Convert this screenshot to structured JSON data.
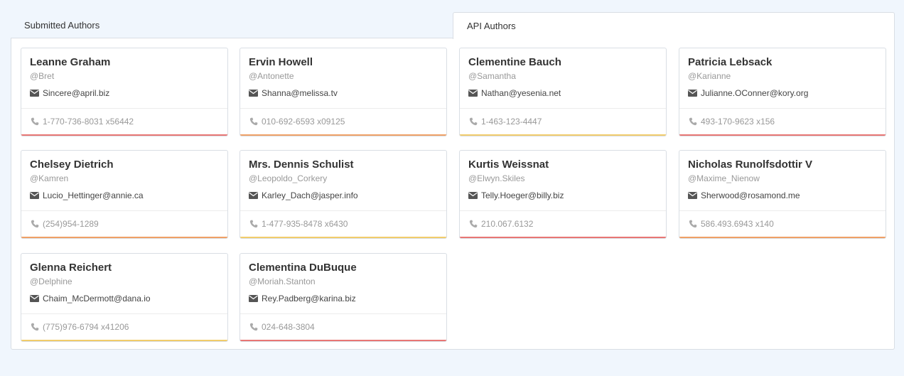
{
  "tabs": [
    {
      "label": "Submitted Authors",
      "active": false
    },
    {
      "label": "API Authors",
      "active": true
    }
  ],
  "accent_colors": {
    "red": "#e87674",
    "orange": "#efa066",
    "yellow": "#f1cc6b"
  },
  "authors": [
    {
      "name": "Leanne Graham",
      "username": "@Bret",
      "email": "Sincere@april.biz",
      "phone": "1-770-736-8031 x56442",
      "accent": "#e87674"
    },
    {
      "name": "Ervin Howell",
      "username": "@Antonette",
      "email": "Shanna@melissa.tv",
      "phone": "010-692-6593 x09125",
      "accent": "#efa066"
    },
    {
      "name": "Clementine Bauch",
      "username": "@Samantha",
      "email": "Nathan@yesenia.net",
      "phone": "1-463-123-4447",
      "accent": "#f1cc6b"
    },
    {
      "name": "Patricia Lebsack",
      "username": "@Karianne",
      "email": "Julianne.OConner@kory.org",
      "phone": "493-170-9623 x156",
      "accent": "#e87674"
    },
    {
      "name": "Chelsey Dietrich",
      "username": "@Kamren",
      "email": "Lucio_Hettinger@annie.ca",
      "phone": "(254)954-1289",
      "accent": "#efa066"
    },
    {
      "name": "Mrs. Dennis Schulist",
      "username": "@Leopoldo_Corkery",
      "email": "Karley_Dach@jasper.info",
      "phone": "1-477-935-8478 x6430",
      "accent": "#f1cc6b"
    },
    {
      "name": "Kurtis Weissnat",
      "username": "@Elwyn.Skiles",
      "email": "Telly.Hoeger@billy.biz",
      "phone": "210.067.6132",
      "accent": "#e87674"
    },
    {
      "name": "Nicholas Runolfsdottir V",
      "username": "@Maxime_Nienow",
      "email": "Sherwood@rosamond.me",
      "phone": "586.493.6943 x140",
      "accent": "#efa066"
    },
    {
      "name": "Glenna Reichert",
      "username": "@Delphine",
      "email": "Chaim_McDermott@dana.io",
      "phone": "(775)976-6794 x41206",
      "accent": "#f1cc6b"
    },
    {
      "name": "Clementina DuBuque",
      "username": "@Moriah.Stanton",
      "email": "Rey.Padberg@karina.biz",
      "phone": "024-648-3804",
      "accent": "#e87674"
    }
  ]
}
